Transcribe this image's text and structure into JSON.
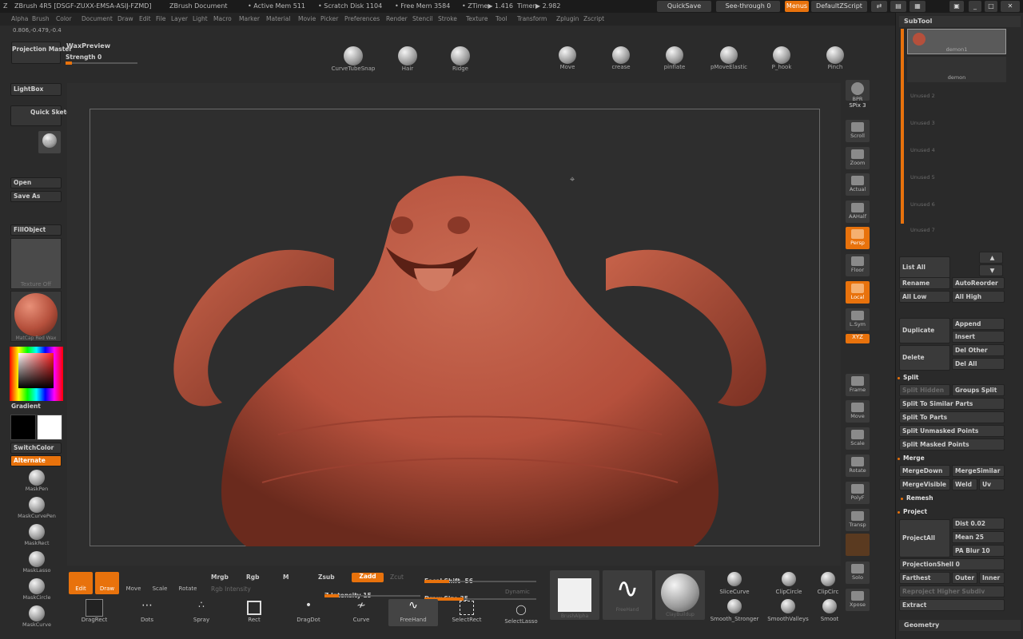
{
  "titlebar": {
    "app": "ZBrush 4R5 [DSGF-ZUXX-EMSA-ASIJ-FZMD]",
    "doc": "ZBrush Document",
    "active_mem": "• Active Mem 511",
    "scratch": "• Scratch Disk 1104",
    "free_mem": "• Free Mem 3584",
    "ztime": "• ZTime▶ 1.416",
    "timer": "Timer▶ 2.982",
    "quicksave": "QuickSave",
    "see_through": "See-through  0",
    "menus": "Menus",
    "default_zscript": "DefaultZScript"
  },
  "menu": [
    "Alpha",
    "Brush",
    "Color",
    "Document",
    "Draw",
    "Edit",
    "File",
    "Layer",
    "Light",
    "Macro",
    "Marker",
    "Material",
    "Movie",
    "Picker",
    "Preferences",
    "Render",
    "Stencil",
    "Stroke",
    "Texture",
    "Tool",
    "Transform",
    "Zplugin",
    "Zscript"
  ],
  "coords": "0.806,-0.479,-0.4",
  "top": {
    "projection_master": "Projection Master",
    "waxpreview": "WaxPreview",
    "strength": "Strength 0",
    "brushes": [
      "CurveTubeSnap",
      "Hair",
      "Ridge",
      "Move",
      "crease",
      "pinflate",
      "pMoveElastic",
      "P_hook",
      "Pinch"
    ]
  },
  "left": {
    "lightbox": "LightBox",
    "quick_sketch": "Quick Sketch",
    "bpr": "BPR",
    "open": "Open",
    "save_as": "Save As",
    "fillobject": "FillObject",
    "texture_off": "Texture Off",
    "matcap": "MatCap Red Wax",
    "gradient": "Gradient",
    "switchcolor": "SwitchColor",
    "alternate": "Alternate",
    "masks": [
      "MaskPen",
      "MaskCurvePen",
      "MaskRect",
      "MaskLasso",
      "MaskCircle",
      "MaskCurve"
    ]
  },
  "right_shelf": [
    "BPR",
    "SPix 3",
    "Scroll",
    "Zoom",
    "Actual",
    "AAHalf",
    "Persp",
    "Floor",
    "Local",
    "L.Sym",
    "XYZ",
    "Frame",
    "Move",
    "Scale",
    "Rotate",
    "PolyF",
    "Transp",
    "Solo",
    "Xpose"
  ],
  "bottom": {
    "edit": "Edit",
    "draw": "Draw",
    "move": "Move",
    "scale": "Scale",
    "rotate": "Rotate",
    "mrgb": "Mrgb",
    "rgb": "Rgb",
    "m": "M",
    "zsub": "Zsub",
    "zadd": "Zadd",
    "zcut": "Zcut",
    "rgb_intensity": "Rgb Intensity",
    "z_intensity": "Z Intensity 15",
    "z_intensity_value": 0.15,
    "focal_shift": "Focal Shift -56",
    "focal_shift_value": 0.22,
    "draw_size": "Draw Size 35",
    "draw_size_value": 0.35,
    "dynamic": "Dynamic",
    "strokes": [
      "DragRect",
      "Dots",
      "Spray",
      "Rect",
      "DragDot",
      "Curve",
      "FreeHand",
      "SelectRect",
      "SelectLasso"
    ],
    "thumbs": [
      "BrushAlpha",
      "FreeHand",
      "ClayBuildup"
    ],
    "brushes2": [
      "SliceCurve",
      "ClipCircle",
      "ClipCirc",
      "Smooth_Stronger",
      "SmoothValleys",
      "Smoot"
    ]
  },
  "subtool": {
    "title": "SubTool",
    "items": [
      "demon1",
      "demon",
      "Unused 2",
      "Unused 3",
      "Unused 4",
      "Unused 5",
      "Unused 6",
      "Unused 7"
    ],
    "list_all": "List All",
    "rename": "Rename",
    "autoreorder": "AutoReorder",
    "all_low": "All Low",
    "all_high": "All High",
    "duplicate": "Duplicate",
    "append": "Append",
    "insert": "Insert",
    "delete": "Delete",
    "del_other": "Del Other",
    "del_all": "Del All",
    "split": "Split",
    "split_hidden": "Split Hidden",
    "groups_split": "Groups Split",
    "split_similar": "Split To Similar Parts",
    "split_parts": "Split To Parts",
    "split_unmasked": "Split Unmasked Points",
    "split_masked": "Split Masked Points",
    "merge": "Merge",
    "mergedown": "MergeDown",
    "mergesimilar": "MergeSimilar",
    "mergevisible": "MergeVisible",
    "weld": "Weld",
    "uv": "Uv",
    "remesh": "Remesh",
    "project": "Project",
    "projectall": "ProjectAll",
    "dist": "Dist 0.02",
    "mean": "Mean 25",
    "pa_blur": "PA Blur 10",
    "projection_shell": "ProjectionShell 0",
    "farthest": "Farthest",
    "outer": "Outer",
    "inner": "Inner",
    "reproject": "Reproject Higher Subdiv",
    "extract": "Extract",
    "geometry": "Geometry"
  },
  "colors": {
    "accent": "#e8720c",
    "clay": "#b5503c",
    "canvas": "#2e2e2e"
  }
}
